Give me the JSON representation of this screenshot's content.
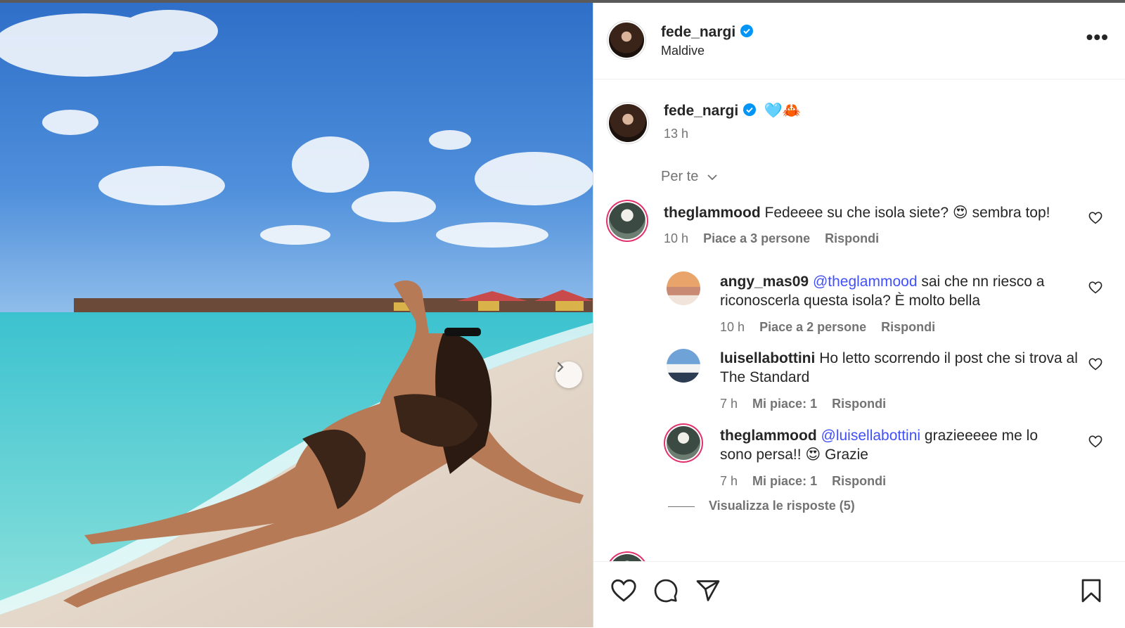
{
  "post": {
    "author": "fede_nargi",
    "location": "Maldive",
    "caption_emoji": "🩵🦀",
    "age": "13 h"
  },
  "filter": {
    "label": "Per te"
  },
  "comments": [
    {
      "username": "theglammood",
      "text": "Fedeeee su che isola siete? 😍 sembra top!",
      "age": "10 h",
      "likes": "Piace a 3 persone",
      "reply": "Rispondi"
    },
    {
      "username": "angy_mas09",
      "mention": "@theglammood",
      "text": " sai che nn riesco a riconoscerla questa isola? È molto bella",
      "age": "10 h",
      "likes": "Piace a 2 persone",
      "reply": "Rispondi"
    },
    {
      "username": "luisellabottini",
      "text": "Ho letto scorrendo il post che si trova al The Standard",
      "age": "7 h",
      "likes": "Mi piace: 1",
      "reply": "Rispondi"
    },
    {
      "username": "theglammood",
      "mention": "@luisellabottini",
      "text": " grazieeeee me lo sono persa!! 😍 Grazie",
      "age": "7 h",
      "likes": "Mi piace: 1",
      "reply": "Rispondi"
    }
  ],
  "view_replies": "Visualizza le risposte (5)",
  "icons": {
    "like": "heart-icon",
    "comment": "comment-icon",
    "share": "share-icon",
    "save": "bookmark-icon",
    "more": "more-options-icon",
    "next": "chevron-right-icon",
    "verified": "verified-badge-icon"
  },
  "colors": {
    "verified": "#0095f6",
    "mention": "#4150f7",
    "story_ring": "#e1306c"
  }
}
